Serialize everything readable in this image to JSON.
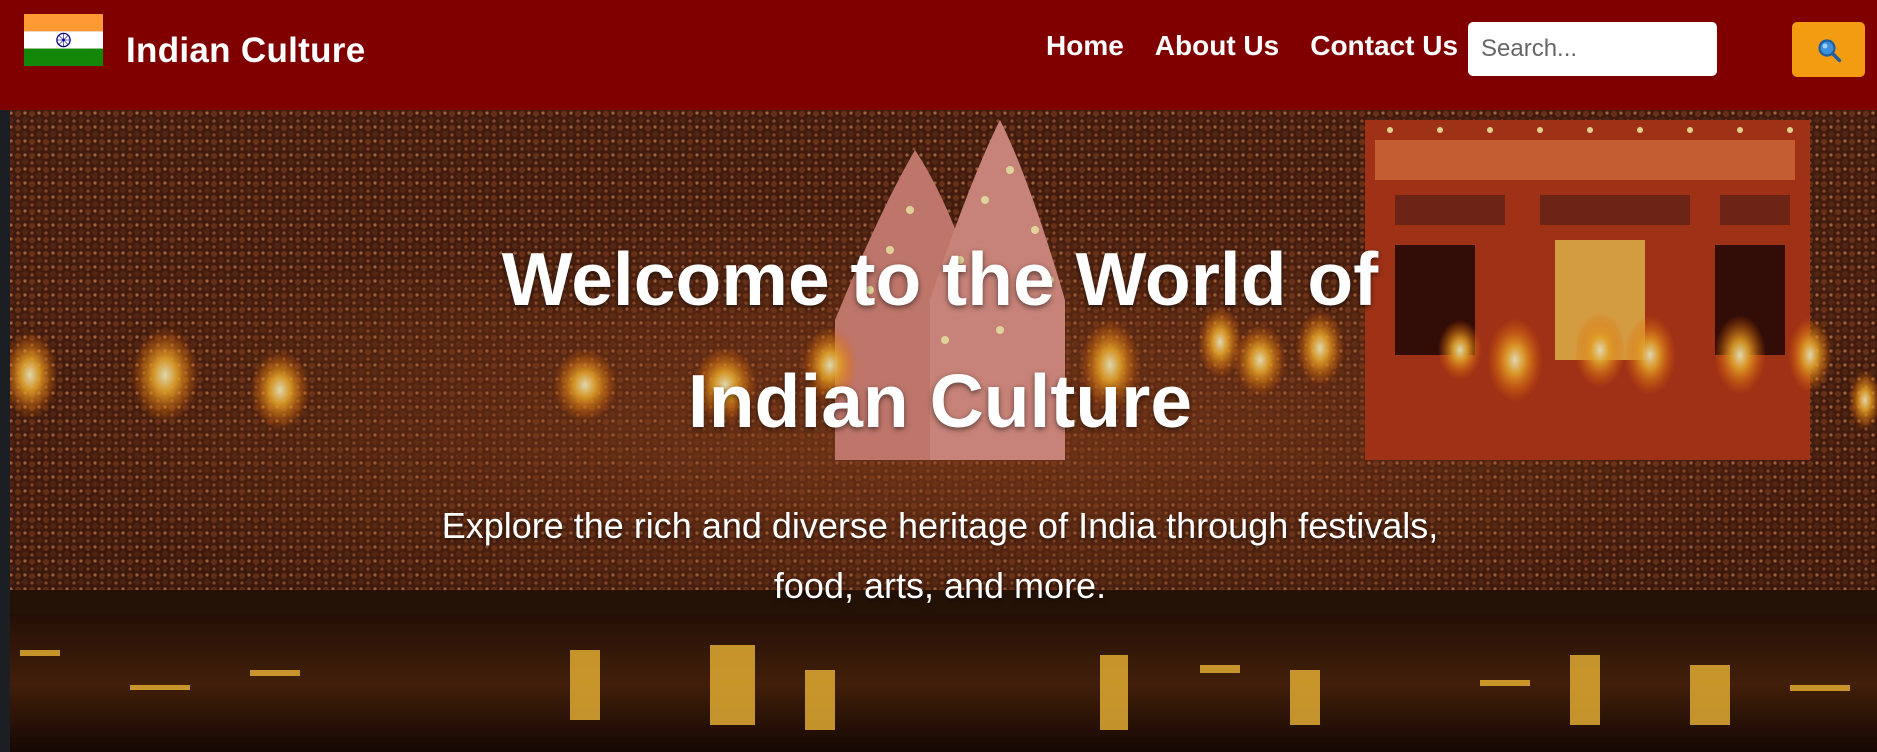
{
  "header": {
    "brand_title": "Indian Culture",
    "flag_icon": "india-flag-icon",
    "nav": [
      {
        "label": "Home"
      },
      {
        "label": "About Us"
      },
      {
        "label": "Contact Us"
      }
    ],
    "search": {
      "value": "",
      "placeholder": "Search...",
      "button_icon": "search-icon"
    }
  },
  "hero": {
    "title": "Welcome to the World of Indian Culture",
    "subtitle": "Explore the rich and diverse heritage of India through festivals, food, arts, and more."
  },
  "colors": {
    "header_bg": "#800000",
    "search_button": "#f39c12",
    "text": "#ffffff",
    "flag_saffron": "#ff9933",
    "flag_white": "#ffffff",
    "flag_green": "#138808",
    "chakra_blue": "#000080"
  }
}
